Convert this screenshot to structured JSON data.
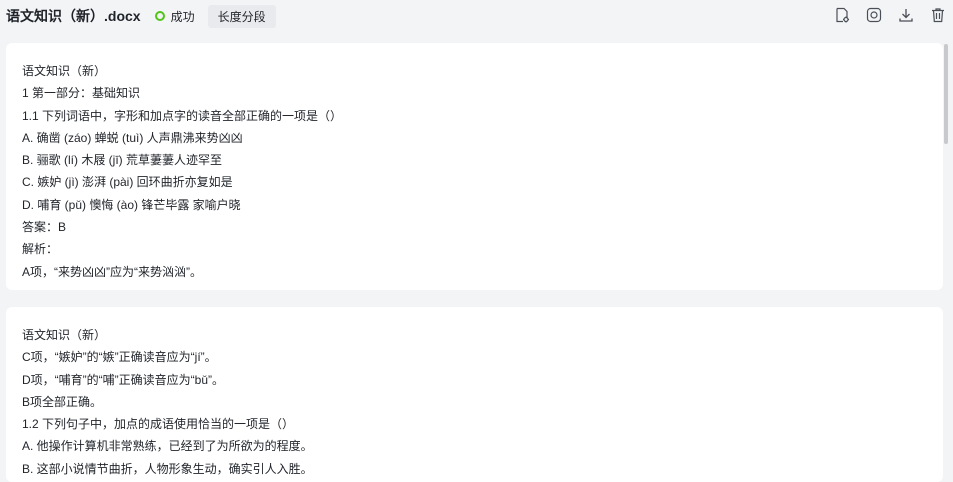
{
  "header": {
    "title": "语文知识（新）.docx",
    "status_label": "成功",
    "tag_label": "长度分段",
    "status_color": "#52c41a"
  },
  "toolbar": {
    "icons": [
      "document-settings-icon",
      "camera-icon",
      "download-icon",
      "trash-icon"
    ]
  },
  "segments": [
    {
      "lines": [
        "语文知识（新）",
        "1 第一部分：基础知识",
        "1.1 下列词语中，字形和加点字的读音全部正确的一项是（）",
        "A. 确凿 (záo) 蝉蜕 (tuì) 人声鼎沸来势凶凶",
        "B. 骊歌 (lí) 木屐 (jī) 荒草萋萋人迹罕至",
        "C. 嫉妒 (jì) 澎湃 (pài) 回环曲折亦复如是",
        "D. 哺育 (pǔ) 懊悔 (ào) 锋芒毕露 家喻户晓",
        "答案：B",
        "解析：",
        "A项，“来势凶凶”应为“来势汹汹”。"
      ]
    },
    {
      "lines": [
        "语文知识（新）",
        "C项，“嫉妒”的“嫉”正确读音应为“jí”。",
        "D项，“哺育”的“哺”正确读音应为“bǔ”。",
        "B项全部正确。",
        "1.2 下列句子中，加点的成语使用恰当的一项是（）",
        "A. 他操作计算机非常熟练，已经到了为所欲为的程度。",
        "B. 这部小说情节曲折，人物形象生动，确实引人入胜。"
      ]
    }
  ]
}
